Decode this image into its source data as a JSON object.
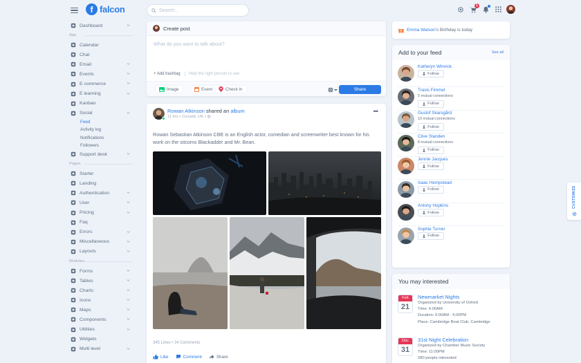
{
  "app": {
    "logo_letter": "f",
    "name": "falcon",
    "accent": "#2c7be5",
    "danger": "#e63757"
  },
  "search": {
    "placeholder": "Search..."
  },
  "topbar": {
    "cart_count": "1"
  },
  "sidebar": {
    "dashboard": "Dashboard",
    "label_app": "App",
    "app_items": [
      "Calendar",
      "Chat",
      "Email",
      "Events",
      "E commerce",
      "E learning",
      "Kanban",
      "Social"
    ],
    "social_sub": [
      "Feed",
      "Activity log",
      "Notifications",
      "Followers"
    ],
    "support": "Support desk",
    "label_pages": "Pages",
    "page_items": [
      "Starter",
      "Landing",
      "Authentication",
      "User",
      "Pricing",
      "Faq",
      "Errors",
      "Miscellaneous",
      "Layouts"
    ],
    "label_modules": "Modules",
    "module_items": [
      "Forms",
      "Tables",
      "Charts",
      "Icons",
      "Maps",
      "Components",
      "Utilities",
      "Widgets",
      "Multi level"
    ]
  },
  "create_post": {
    "title": "Create post",
    "placeholder": "What do you want to talk about?",
    "add_hashtag": "Add hashtag",
    "hashtag_placeholder": "Help the right person to see",
    "image": "Image",
    "event": "Event",
    "checkin": "Check in",
    "share": "Share"
  },
  "post": {
    "author": "Rowan Atkinson",
    "verb": "shared an",
    "object": "album",
    "meta": "11 hrs • Consett, UK •",
    "body": "Rowan Sebastian Atkinson CBE is an English actor, comedian and screenwriter best known for his work on the sitcoms Blackadder and Mr. Bean.",
    "stats": "345 Likes • 34 Comments",
    "like": "Like",
    "comment": "Comment",
    "share": "Share"
  },
  "birthday": {
    "name": "Emma Watson",
    "text": "'s Birthday is today"
  },
  "feed": {
    "title": "Add to your feed",
    "see_all": "See all",
    "follow_label": "Follow",
    "people": [
      {
        "name": "Katheryn Winnick",
        "conn": ""
      },
      {
        "name": "Travis Fimmel",
        "conn": "5 mutual connections"
      },
      {
        "name": "Gustof Skarsgård",
        "conn": "10 mutual connections"
      },
      {
        "name": "Clive Standen",
        "conn": "8 mutual connections"
      },
      {
        "name": "Jennie Jacques",
        "conn": ""
      },
      {
        "name": "Isaac Hempstead",
        "conn": ""
      },
      {
        "name": "Antony Hopkins",
        "conn": ""
      },
      {
        "name": "Sophie Turner",
        "conn": ""
      }
    ]
  },
  "interested": {
    "title": "You may interested",
    "events": [
      {
        "month": "Feb",
        "day": "21",
        "title": "Newmarket Nights",
        "lines": [
          "Organized by University of Oxford",
          "Time: 6:00AM",
          "Duration: 6:00AM - 5:00PM",
          "Place: Cambridge Boat Club, Cambridge"
        ]
      },
      {
        "month": "Dec",
        "day": "31",
        "title": "31st Night Celebration",
        "lines": [
          "Organized by Chamber Music Society",
          "Time: 11:00PM",
          "280 people interested"
        ]
      }
    ]
  },
  "customize": "CUSTOMIZE"
}
